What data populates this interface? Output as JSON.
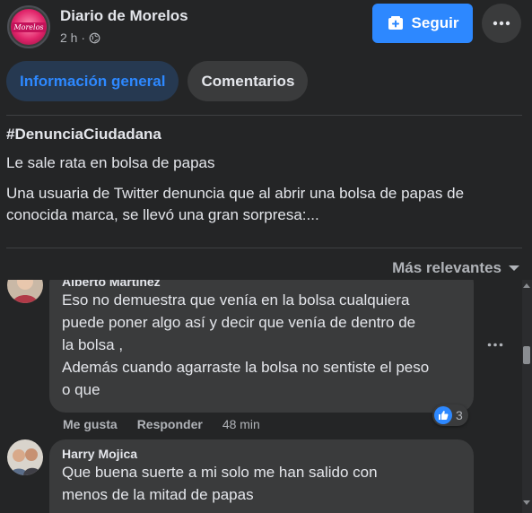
{
  "page": {
    "name": "Diario de Morelos",
    "time": "2 h ·",
    "logo_text": "Morelos",
    "follow_label": "Seguir",
    "accent_color": "#2d88ff"
  },
  "tabs": [
    {
      "label": "Información general",
      "active": true
    },
    {
      "label": "Comentarios",
      "active": false
    }
  ],
  "post": {
    "hashtag": "#DenunciaCiudadana",
    "subtitle": "Le sale rata en bolsa de papas",
    "text": "Una usuaria de Twitter denuncia que al abrir una bolsa de papas de conocida marca, se llevó una gran sorpresa:..."
  },
  "sort_label": "Más relevantes",
  "comments": [
    {
      "author": "Alberto Martínez",
      "text": "Eso no demuestra que venía en la bolsa cualquiera\npuede poner algo así y decir que venía de dentro de\nla bolsa ,\nAdemás cuando agarraste la bolsa no sentiste el peso\no que",
      "like_label": "Me gusta",
      "reply_label": "Responder",
      "time": "48 min",
      "reactions": "3"
    },
    {
      "author": "Harry Mojica",
      "text": "Que buena suerte a mi solo me han salido con\nmenos de la mitad de papas"
    }
  ]
}
